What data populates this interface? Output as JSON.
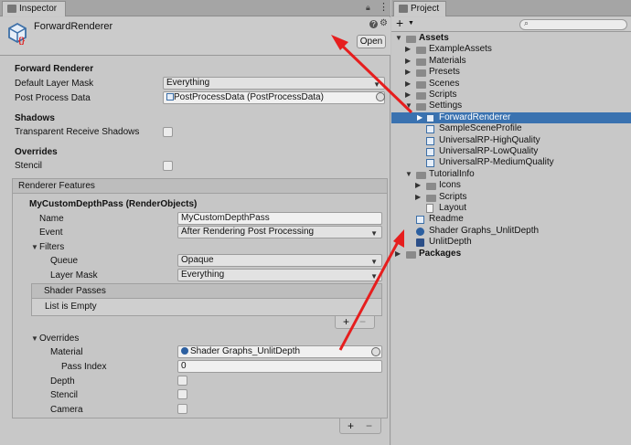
{
  "inspector": {
    "tab_label": "Inspector",
    "title": "ForwardRenderer",
    "open_label": "Open",
    "section_title": "Forward Renderer",
    "default_layer_mask_label": "Default Layer Mask",
    "default_layer_mask_value": "Everything",
    "post_process_label": "Post Process Data",
    "post_process_value": "PostProcessData (PostProcessData)",
    "shadows_title": "Shadows",
    "transparent_shadows_label": "Transparent Receive Shadows",
    "overrides_title": "Overrides",
    "stencil_label": "Stencil",
    "renderer_features_title": "Renderer Features",
    "feature": {
      "title": "MyCustomDepthPass (RenderObjects)",
      "name_label": "Name",
      "name_value": "MyCustomDepthPass",
      "event_label": "Event",
      "event_value": "After Rendering Post Processing",
      "filters_label": "Filters",
      "queue_label": "Queue",
      "queue_value": "Opaque",
      "layer_mask_label": "Layer Mask",
      "layer_mask_value": "Everything",
      "shader_passes_label": "Shader Passes",
      "list_empty_label": "List is Empty",
      "overrides_label": "Overrides",
      "material_label": "Material",
      "material_value": "Shader Graphs_UnlitDepth",
      "pass_index_label": "Pass Index",
      "pass_index_value": "0",
      "depth_label": "Depth",
      "stencil_label": "Stencil",
      "camera_label": "Camera"
    },
    "plus": "+",
    "minus": "−"
  },
  "project": {
    "tab_label": "Project",
    "add_label": "+",
    "tree": [
      {
        "label": "Assets",
        "bold": true,
        "expanded": true,
        "type": "folder"
      },
      {
        "label": "ExampleAssets",
        "type": "folder"
      },
      {
        "label": "Materials",
        "type": "folder"
      },
      {
        "label": "Presets",
        "type": "folder"
      },
      {
        "label": "Scenes",
        "type": "folder"
      },
      {
        "label": "Scripts",
        "type": "folder"
      },
      {
        "label": "Settings",
        "type": "folder",
        "expanded": true
      },
      {
        "label": "ForwardRenderer",
        "type": "asset",
        "selected": true
      },
      {
        "label": "SampleSceneProfile",
        "type": "asset"
      },
      {
        "label": "UniversalRP-HighQuality",
        "type": "asset"
      },
      {
        "label": "UniversalRP-LowQuality",
        "type": "asset"
      },
      {
        "label": "UniversalRP-MediumQuality",
        "type": "asset"
      },
      {
        "label": "TutorialInfo",
        "type": "folder",
        "expanded": true
      },
      {
        "label": "Icons",
        "type": "folder"
      },
      {
        "label": "Scripts",
        "type": "folder"
      },
      {
        "label": "Layout",
        "type": "file"
      },
      {
        "label": "Readme",
        "type": "asset"
      },
      {
        "label": "Shader Graphs_UnlitDepth",
        "type": "material"
      },
      {
        "label": "UnlitDepth",
        "type": "shader"
      },
      {
        "label": "Packages",
        "bold": true,
        "type": "folder"
      }
    ]
  },
  "colors": {
    "selection": "#3a72b0",
    "annotation_arrow": "#e61e1e"
  }
}
